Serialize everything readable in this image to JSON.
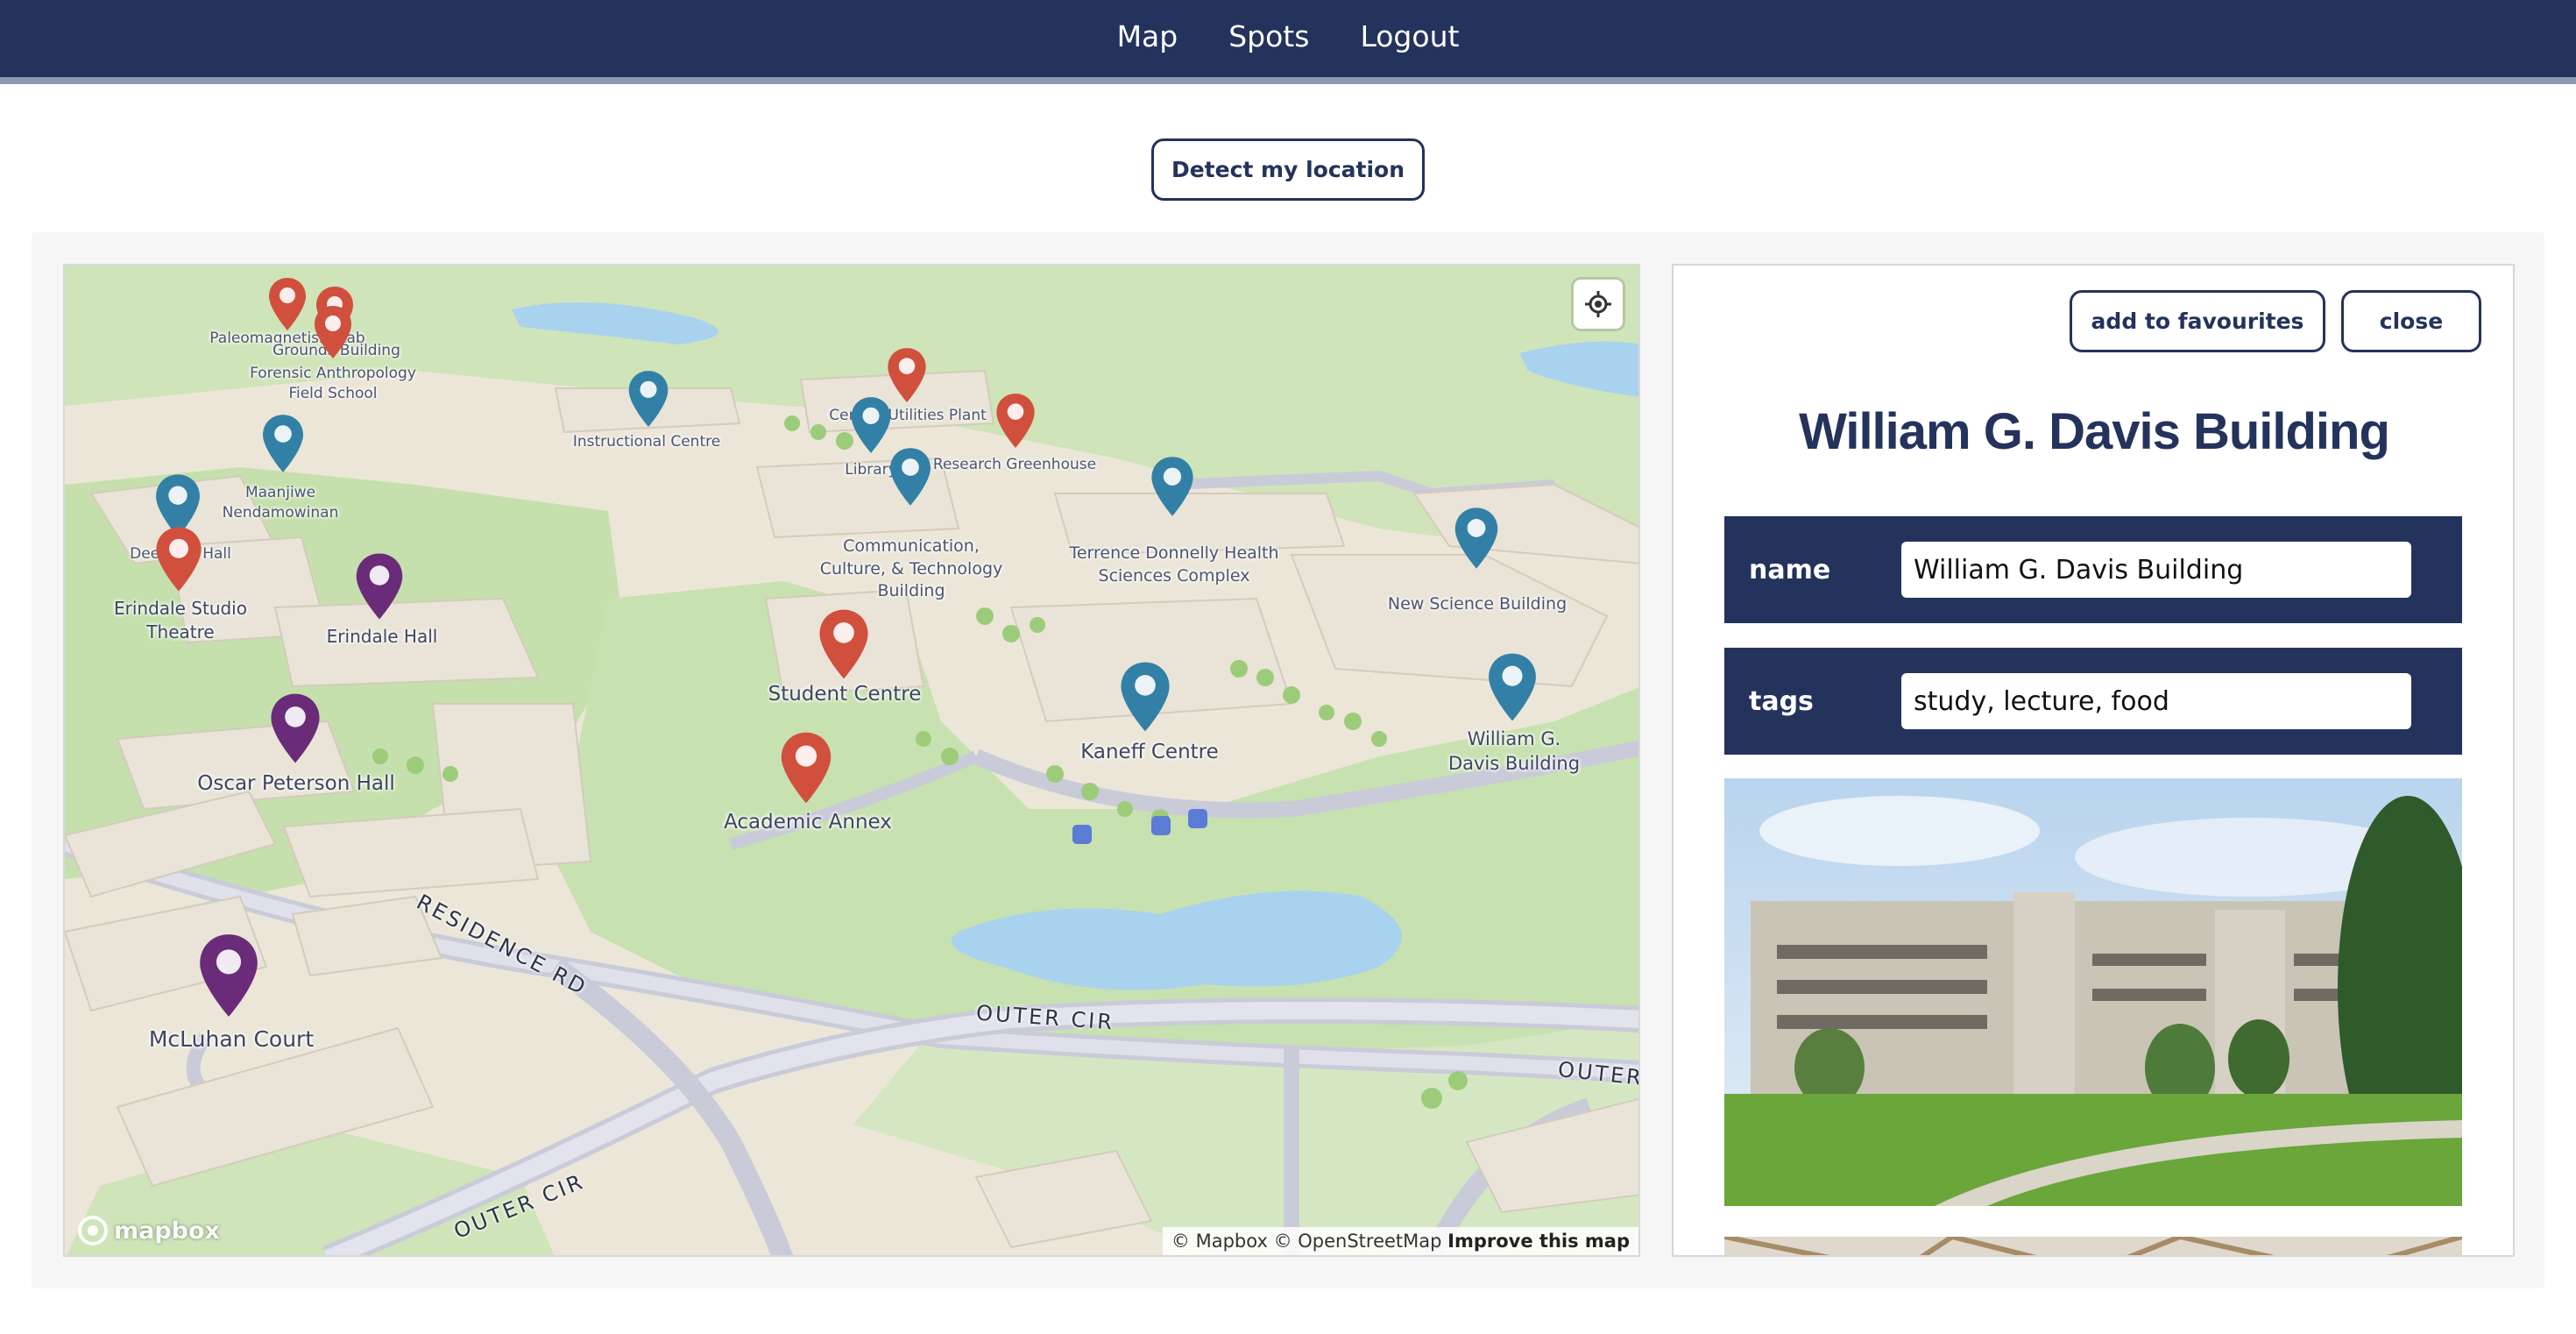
{
  "nav": {
    "items": [
      "Map",
      "Spots",
      "Logout"
    ]
  },
  "detect_button": "Detect my location",
  "map": {
    "labels": {
      "paleomagnetism_lab": "Paleomagnetism Lab",
      "grounds_building": "Grounds Building",
      "forensic_school": "Forensic Anthropology\nField School",
      "instructional_centre": "Instructional Centre",
      "central_utilities_plant": "Central Utilities Plant",
      "library": "Library",
      "research_greenhouse": "Research Greenhouse",
      "maanjiwe": "Maanjiwe\nNendamowinan",
      "deerfield_hall": "Deerfield Hall",
      "erindale_studio_theatre": "Erindale Studio\nTheatre",
      "erindale_hall": "Erindale Hall",
      "ccit": "Communication,\nCulture, & Technology\nBuilding",
      "terrence_donnelly": "Terrence Donnelly Health\nSciences Complex",
      "new_science_building": "New Science Building",
      "student_centre": "Student Centre",
      "kaneff_centre": "Kaneff Centre",
      "william_davis": "William G.\nDavis Building",
      "oscar_peterson_hall": "Oscar Peterson Hall",
      "academic_annex": "Academic Annex",
      "mcluhan_court": "McLuhan Court"
    },
    "roads": {
      "residence_rd": "RESIDENCE RD",
      "outer_cir_1": "OUTER CIR",
      "outer_cir_2": "OUTER CIR",
      "outer_cir_3": "OUTER"
    },
    "attribution": {
      "mapbox": "© Mapbox",
      "osm": "© OpenStreetMap",
      "improve": "Improve this map"
    },
    "logo_text": "mapbox",
    "pin_colors": {
      "red": "#d0503d",
      "blue": "#3380a6",
      "purple": "#6a2b79"
    }
  },
  "detail": {
    "add_favourites": "add to favourites",
    "close": "close",
    "title": "William G. Davis Building",
    "fields": {
      "name_label": "name",
      "name_value": "William G. Davis Building",
      "tags_label": "tags",
      "tags_value": "study, lecture, food"
    }
  }
}
